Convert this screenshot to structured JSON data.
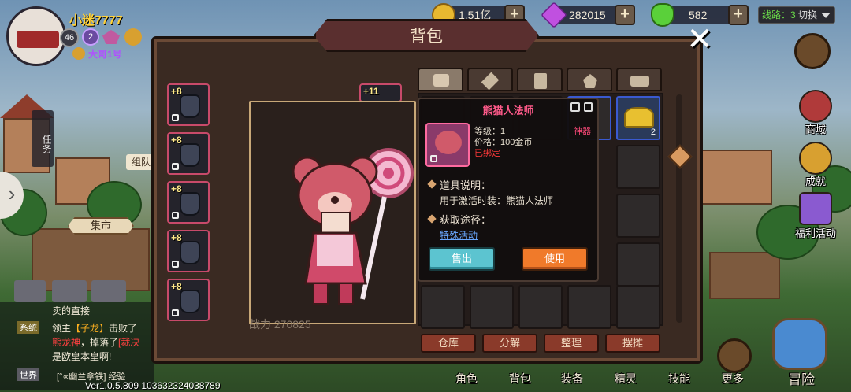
{
  "player": {
    "name": "小迷7777",
    "level": "46",
    "vip": "2",
    "title": "大哥1号"
  },
  "currency": {
    "gold": "1.51亿",
    "diamond": "282015",
    "stamina": "582",
    "plus": "+"
  },
  "hud": {
    "line_status": "线路：3",
    "switch": "切换"
  },
  "left": {
    "quest": "任务",
    "team": "组队",
    "market": "集市"
  },
  "chat": [
    {
      "text": "卖的直接"
    },
    {
      "channel": "系统",
      "text_a": "领主",
      "who": "【子龙】",
      "text_b": "击败了",
      "boss": "熊龙神",
      "text_c": "，掉落了",
      "item": "[裁决",
      "text_d": "是欧皇本皇啊!"
    },
    {
      "channel": "世界",
      "text": "[°∝幽兰拿铁] 经验"
    }
  ],
  "panel": {
    "title": "背包",
    "close": "✕",
    "power": "战力 270825"
  },
  "equip": [
    "+8",
    "+8",
    "+8",
    "+8",
    "+8",
    "+11"
  ],
  "grid": {
    "gold_pile_count": "2"
  },
  "actions": [
    "仓库",
    "分解",
    "整理",
    "摆摊"
  ],
  "tooltip": {
    "name": "熊猫人法师",
    "level": "等级：1",
    "price": "价格：100金币",
    "bound": "已绑定",
    "rarity": "神器",
    "desc_label": "道具说明：",
    "desc": "用于激活时装：熊猫人法师",
    "source_label": "获取途径：",
    "source": "特殊活动",
    "sell": "售出",
    "use": "使用"
  },
  "side": [
    "商城",
    "成就",
    "福利活动"
  ],
  "nav": [
    "角色",
    "背包",
    "装备",
    "精灵",
    "技能",
    "更多",
    "冒险"
  ],
  "version": "Ver1.0.5.809  103632324038789"
}
